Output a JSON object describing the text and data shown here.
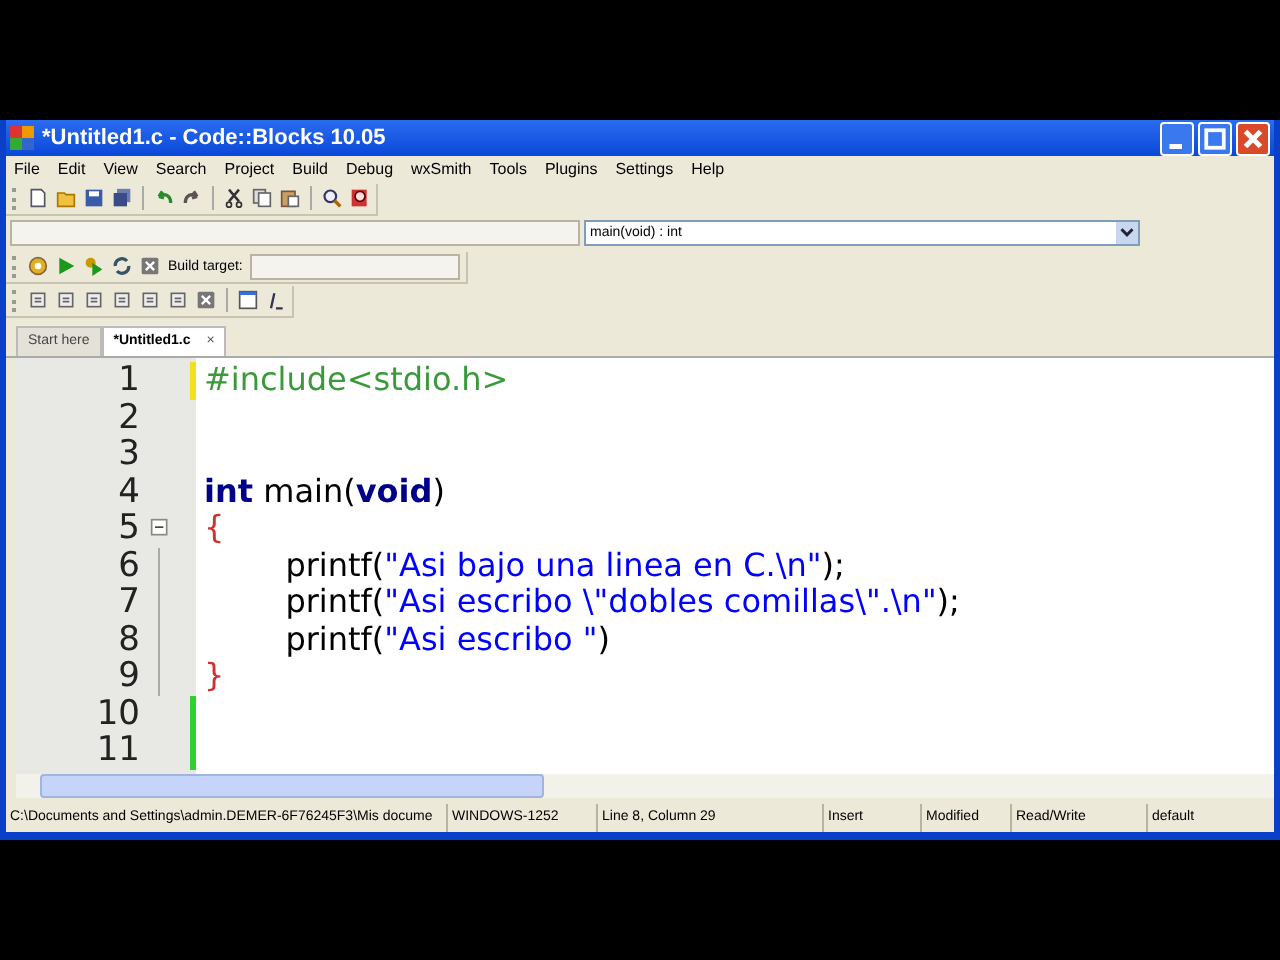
{
  "window": {
    "title": "*Untitled1.c - Code::Blocks 10.05"
  },
  "menu": [
    "File",
    "Edit",
    "View",
    "Search",
    "Project",
    "Build",
    "Debug",
    "wxSmith",
    "Tools",
    "Plugins",
    "Settings",
    "Help"
  ],
  "scope_combo": {
    "value": "main(void) : int"
  },
  "build_target": {
    "label": "Build target:"
  },
  "tabs": [
    {
      "label": "Start here",
      "selected": false
    },
    {
      "label": "*Untitled1.c",
      "selected": true,
      "close": "×"
    }
  ],
  "editor": {
    "lines": [
      {
        "number": "1",
        "unsaved": true,
        "saved": false,
        "fold_start": false,
        "in_fold": false,
        "tokens": [
          {
            "kind": "preprocessor",
            "text": "#include<stdio.h>"
          }
        ]
      },
      {
        "number": "2",
        "unsaved": false,
        "saved": false,
        "fold_start": false,
        "in_fold": false
      },
      {
        "number": "3",
        "unsaved": false,
        "saved": false,
        "fold_start": false,
        "in_fold": false
      },
      {
        "number": "4",
        "unsaved": false,
        "saved": false,
        "fold_start": false,
        "in_fold": false,
        "tokens": [
          {
            "kind": "keyword",
            "text": "int"
          },
          {
            "kind": "plain",
            "text": " main("
          },
          {
            "kind": "keyword",
            "text": "void"
          },
          {
            "kind": "plain",
            "text": ")"
          }
        ]
      },
      {
        "number": "5",
        "unsaved": false,
        "saved": false,
        "fold_start": true,
        "in_fold": false,
        "tokens": [
          {
            "kind": "brace",
            "text": "{"
          }
        ]
      },
      {
        "number": "6",
        "unsaved": false,
        "saved": false,
        "fold_start": false,
        "in_fold": true,
        "tokens": [
          {
            "kind": "plain",
            "text": "        printf("
          },
          {
            "kind": "string",
            "text": "\"Asi bajo una linea en C.\\n\""
          },
          {
            "kind": "plain",
            "text": ");"
          }
        ]
      },
      {
        "number": "7",
        "unsaved": false,
        "saved": false,
        "fold_start": false,
        "in_fold": true,
        "tokens": [
          {
            "kind": "plain",
            "text": "        printf("
          },
          {
            "kind": "string",
            "text": "\"Asi escribo \\\"dobles comillas\\\".\\n\""
          },
          {
            "kind": "plain",
            "text": ");"
          }
        ]
      },
      {
        "number": "8",
        "unsaved": false,
        "saved": false,
        "fold_start": false,
        "in_fold": true,
        "tokens": [
          {
            "kind": "plain",
            "text": "        printf("
          },
          {
            "kind": "string",
            "text": "\"Asi escribo \""
          },
          {
            "kind": "plain",
            "text": ")"
          }
        ]
      },
      {
        "number": "9",
        "unsaved": false,
        "saved": false,
        "fold_start": false,
        "in_fold": true,
        "tokens": [
          {
            "kind": "brace",
            "text": "}"
          }
        ]
      },
      {
        "number": "10",
        "unsaved": false,
        "saved": true,
        "fold_start": false,
        "in_fold": false
      },
      {
        "number": "11",
        "unsaved": false,
        "saved": true,
        "fold_start": false,
        "in_fold": false
      }
    ]
  },
  "status_bar": [
    {
      "kind": "path",
      "text": "C:\\Documents and Settings\\admin.DEMER-6F76245F3\\Mis docume"
    },
    {
      "kind": "encoding",
      "text": "WINDOWS-1252"
    },
    {
      "kind": "position",
      "text": "Line 8, Column 29"
    },
    {
      "kind": "mode",
      "text": "Insert"
    },
    {
      "kind": "modified",
      "text": "Modified"
    },
    {
      "kind": "access",
      "text": "Read/Write"
    },
    {
      "kind": "lexer",
      "text": "default"
    }
  ]
}
